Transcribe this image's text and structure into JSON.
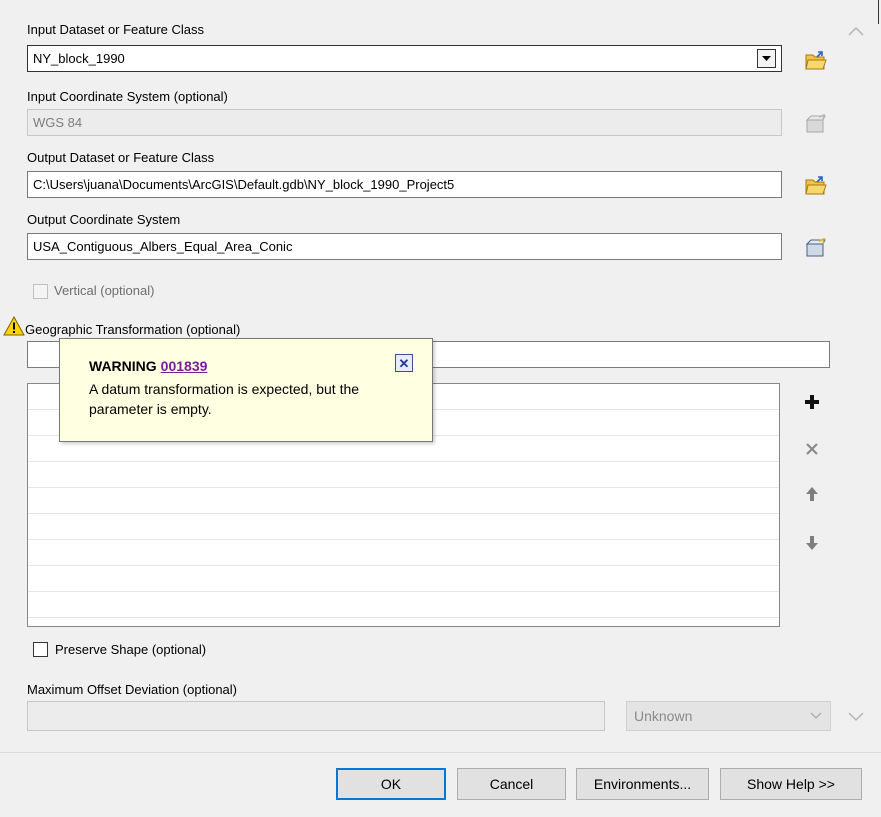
{
  "input_dataset": {
    "label": "Input Dataset or Feature Class",
    "value": "NY_block_1990"
  },
  "input_coord_sys": {
    "label": "Input Coordinate System (optional)",
    "value": "WGS 84"
  },
  "output_dataset": {
    "label": "Output Dataset or Feature Class",
    "value": "C:\\Users\\juana\\Documents\\ArcGIS\\Default.gdb\\NY_block_1990_Project5"
  },
  "output_coord_sys": {
    "label": "Output Coordinate System",
    "value": "USA_Contiguous_Albers_Equal_Area_Conic"
  },
  "vertical": {
    "label": "Vertical (optional)",
    "checked": false
  },
  "geo_transform": {
    "label": "Geographic Transformation (optional)",
    "value": ""
  },
  "warning": {
    "title": "WARNING",
    "code": "001839",
    "message": "A datum transformation is expected, but the parameter is empty.",
    "close_icon": "close-icon"
  },
  "preserve_shape": {
    "label": "Preserve Shape (optional)",
    "checked": false
  },
  "max_offset": {
    "label": "Maximum Offset Deviation (optional)",
    "value": "",
    "unit": "Unknown"
  },
  "buttons": {
    "ok": "OK",
    "cancel": "Cancel",
    "environments": "Environments...",
    "show_help": "Show Help >>"
  },
  "colors": {
    "warning_bg": "#ffffe1",
    "link": "#7a1c9c",
    "default_button_border": "#0078d7",
    "folder_icon": "#e8b339"
  }
}
